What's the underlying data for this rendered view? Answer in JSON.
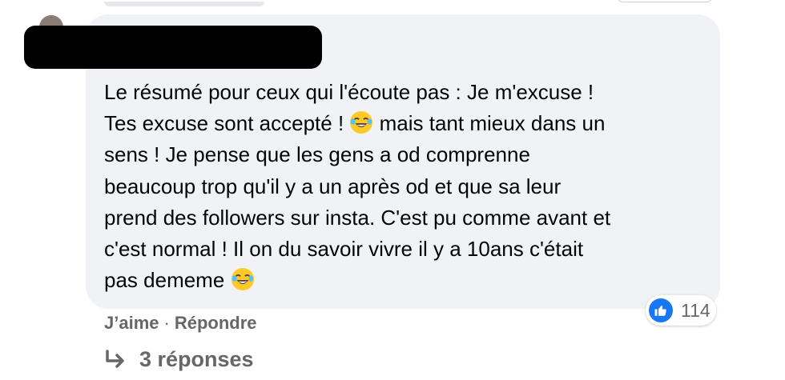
{
  "comment": {
    "lines": [
      "Le résumé pour ceux qui l'écoute pas : Je m'excuse !",
      "Tes excuse sont accepté ! ",
      " mais tant mieux dans un",
      "sens ! Je pense que les gens a od comprenne",
      "beaucoup trop qu'il y a un après od et que sa leur",
      "prend des followers sur insta. C'est pu comme avant et",
      "c'est normal ! Il on du savoir vivre il y a 10ans c'était",
      "pas dememe "
    ],
    "emoji": "laughing-tears-emoji"
  },
  "reaction": {
    "icon": "like-icon",
    "count": "114",
    "color": "#1877f2"
  },
  "actions": {
    "like_label": "J’aime",
    "separator": "·",
    "reply_label": "Répondre"
  },
  "replies": {
    "icon": "reply-arrow-icon",
    "label": "3 réponses"
  },
  "colors": {
    "bubble": "#f0f2f5",
    "text": "#050505",
    "muted": "#65676b"
  }
}
